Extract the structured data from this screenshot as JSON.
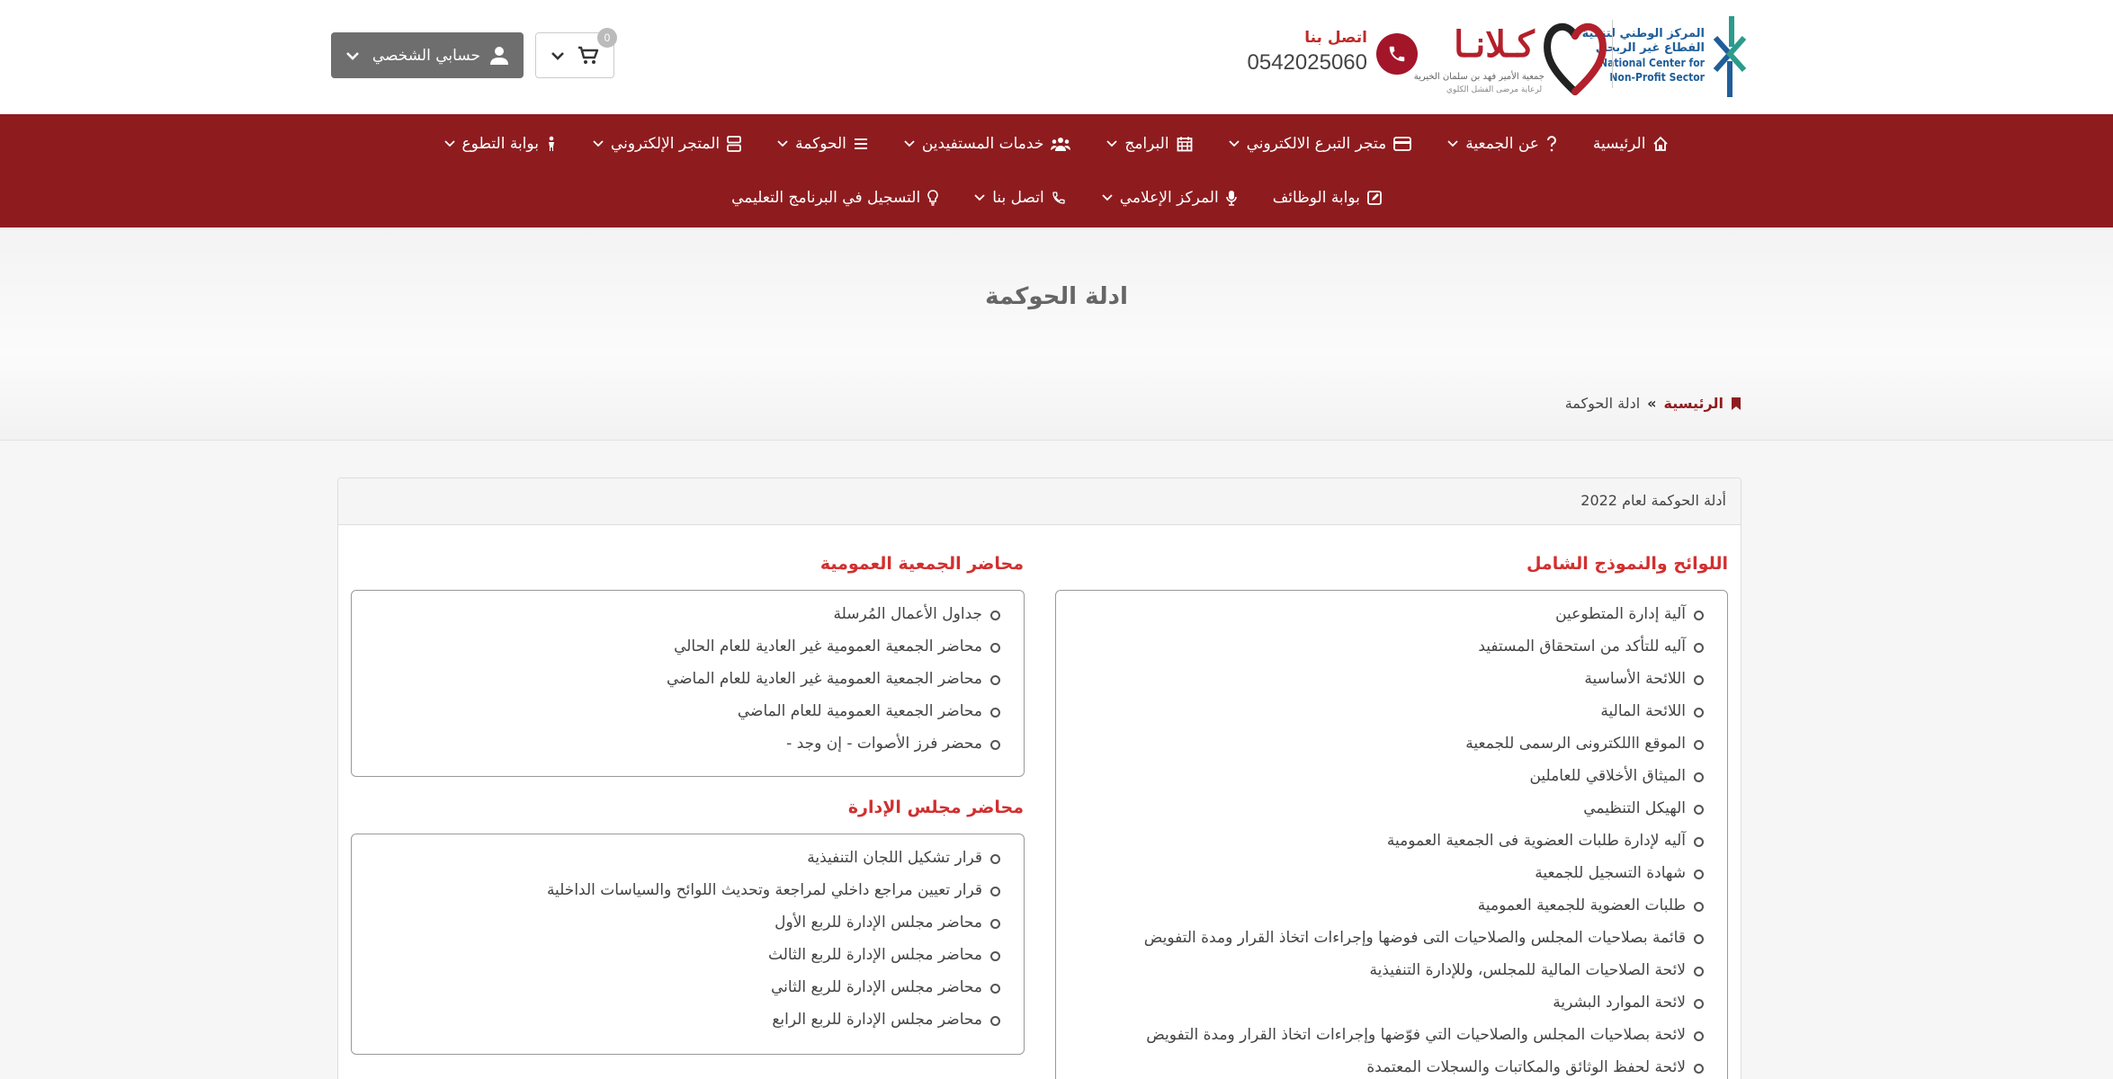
{
  "header": {
    "ncnp_logo": {
      "ar_line1": "المركز الوطني لتنمية",
      "ar_line2": "القطاع غير الربحي",
      "en_line1": "National Center for",
      "en_line2": "Non-Profit Sector"
    },
    "klana_logo": {
      "word": "كـلانـا",
      "sub1": "جمعية الأمير فهد بن سلمان الخيرية",
      "sub2": "لرعاية مرضى الفشل الكلوي"
    },
    "contact_label": "اتصل بنا",
    "contact_number": "0542025060",
    "cart_count": "0",
    "account_label": "حسابي الشخصي"
  },
  "nav": {
    "row1": [
      {
        "label": "الرئيسية",
        "icon": "home-icon"
      },
      {
        "label": "عن الجمعية",
        "icon": "question-icon"
      },
      {
        "label": "متجر التبرع الالكتروني",
        "icon": "card-icon"
      },
      {
        "label": "البرامج",
        "icon": "calendar-icon"
      },
      {
        "label": "خدمات المستفيدين",
        "icon": "users-icon"
      },
      {
        "label": "الحوكمة",
        "icon": "list-icon"
      },
      {
        "label": "المتجر الإلكتروني",
        "icon": "server-icon"
      },
      {
        "label": "بوابة التطوع",
        "icon": "person-icon"
      }
    ],
    "row2": [
      {
        "label": "بوابة الوظائف",
        "icon": "edit-icon"
      },
      {
        "label": "المركز الإعلامي",
        "icon": "mic-icon"
      },
      {
        "label": "اتصل بنا",
        "icon": "phone-icon"
      },
      {
        "label": "التسجيل في البرنامج التعليمي",
        "icon": "bulb-icon"
      }
    ]
  },
  "page": {
    "title": "ادلة الحوكمة",
    "breadcrumb_home": "الرئيسية",
    "breadcrumb_sep": "»",
    "breadcrumb_current": "ادلة الحوكمة"
  },
  "panel": {
    "heading": "أدلة الحوكمة لعام 2022",
    "regulations": {
      "title": "اللوائح والنموذج الشامل",
      "items": [
        "آلية إدارة المتطوعين",
        "آليه للتأكد من استحقاق المستفيد",
        "اللائحة الأساسية",
        "اللائحة المالية",
        "الموقع االلكترونى الرسمى للجمعية",
        "الميثاق الأخلاقي للعاملين",
        "الهيكل التنظيمي",
        "آليه لإدارة طلبات العضوية فى الجمعية العمومية",
        "شهادة التسجيل للجمعية",
        "طلبات العضوية للجمعية العمومية",
        "قائمة بصلاحيات المجلس والصلاحيات التى فوضها وإجراءات اتخاذ القرار ومدة التفويض",
        "لائحة الصلاحيات المالية للمجلس، وللإدارة التنفيذية",
        "لائحة الموارد البشرية",
        "لائحة بصلاحيات المجلس والصلاحيات التي فوّضها وإجراءات اتخاذ القرار ومدة التفويض",
        "لائحة لحفظ الوثائق والمكاتبات والسجلات المعتمدة"
      ]
    },
    "assembly": {
      "title": "محاضر الجمعية العمومية",
      "items": [
        "جداول الأعمال المُرسلة",
        "محاضر الجمعية العمومية غير العادية للعام الحالي",
        "محاضر الجمعية العمومية غير العادية للعام الماضي",
        "محاضر الجمعية العمومية للعام الماضي",
        "محضر فرز الأصوات - إن وجد -"
      ]
    },
    "board": {
      "title": "محاضر مجلس الإدارة",
      "items": [
        "قرار تشكيل اللجان التنفيذية",
        "قرار تعيين مراجع داخلي لمراجعة وتحديث اللوائح والسياسات الداخلية",
        "محاضر مجلس الإدارة للربع الأول",
        "محاضر مجلس الإدارة للربع الثالث",
        "محاضر مجلس الإدارة للربع الثاني",
        "محاضر مجلس الإدارة للربع الرابع"
      ]
    }
  },
  "colors": {
    "brand": "#8e1c1f",
    "accent_red": "#d22f2f",
    "account_bg": "#6e6e6e"
  }
}
